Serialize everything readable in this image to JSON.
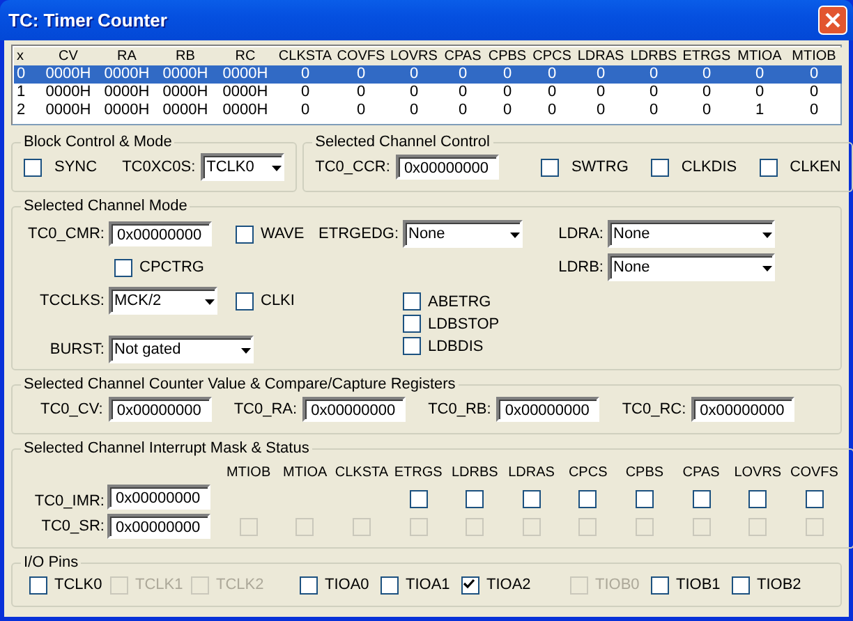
{
  "window": {
    "title": "TC: Timer Counter"
  },
  "table": {
    "columns": [
      "x",
      "CV",
      "RA",
      "RB",
      "RC",
      "CLKSTA",
      "COVFS",
      "LOVRS",
      "CPAS",
      "CPBS",
      "CPCS",
      "LDRAS",
      "LDRBS",
      "ETRGS",
      "MTIOA",
      "MTIOB"
    ],
    "rows": [
      {
        "selected": true,
        "cells": [
          "0",
          "0000H",
          "0000H",
          "0000H",
          "0000H",
          "0",
          "0",
          "0",
          "0",
          "0",
          "0",
          "0",
          "0",
          "0",
          "0",
          "0"
        ]
      },
      {
        "selected": false,
        "cells": [
          "1",
          "0000H",
          "0000H",
          "0000H",
          "0000H",
          "0",
          "0",
          "0",
          "0",
          "0",
          "0",
          "0",
          "0",
          "0",
          "0",
          "0"
        ]
      },
      {
        "selected": false,
        "cells": [
          "2",
          "0000H",
          "0000H",
          "0000H",
          "0000H",
          "0",
          "0",
          "0",
          "0",
          "0",
          "0",
          "0",
          "0",
          "0",
          "1",
          "0"
        ]
      }
    ]
  },
  "block_control": {
    "title": "Block Control & Mode",
    "sync": {
      "label": "SYNC",
      "checked": false
    },
    "xc0s": {
      "label": "TC0XC0S:",
      "value": "TCLK0"
    }
  },
  "channel_control": {
    "title": "Selected Channel Control",
    "ccr": {
      "label": "TC0_CCR:",
      "value": "0x00000000"
    },
    "toggles": [
      {
        "label": "SWTRG",
        "checked": false
      },
      {
        "label": "CLKDIS",
        "checked": false
      },
      {
        "label": "CLKEN",
        "checked": false
      }
    ]
  },
  "channel_mode": {
    "title": "Selected Channel Mode",
    "cmr": {
      "label": "TC0_CMR:",
      "value": "0x00000000"
    },
    "wave": {
      "label": "WAVE",
      "checked": false
    },
    "etrgedg": {
      "label": "ETRGEDG:",
      "value": "None"
    },
    "ldra": {
      "label": "LDRA:",
      "value": "None"
    },
    "cpctrg": {
      "label": "CPCTRG",
      "checked": false
    },
    "ldrb": {
      "label": "LDRB:",
      "value": "None"
    },
    "tcclks": {
      "label": "TCCLKS:",
      "value": "MCK/2"
    },
    "clki": {
      "label": "CLKI",
      "checked": false
    },
    "abetrg": {
      "label": "ABETRG",
      "checked": false
    },
    "ldbstop": {
      "label": "LDBSTOP",
      "checked": false
    },
    "burst": {
      "label": "BURST:",
      "value": "Not gated"
    },
    "ldbdis": {
      "label": "LDBDIS",
      "checked": false
    }
  },
  "registers": {
    "title": "Selected Channel Counter Value & Compare/Capture Registers",
    "fields": [
      {
        "label": "TC0_CV:",
        "value": "0x00000000"
      },
      {
        "label": "TC0_RA:",
        "value": "0x00000000"
      },
      {
        "label": "TC0_RB:",
        "value": "0x00000000"
      },
      {
        "label": "TC0_RC:",
        "value": "0x00000000"
      }
    ]
  },
  "interrupts": {
    "title": "Selected Channel Interrupt Mask & Status",
    "imr": {
      "label": "TC0_IMR:",
      "value": "0x00000000"
    },
    "sr": {
      "label": "TC0_SR:",
      "value": "0x00000000"
    },
    "bits": [
      {
        "label": "MTIOB",
        "status": {
          "checked": false,
          "disabled": true
        }
      },
      {
        "label": "MTIOA",
        "status": {
          "checked": false,
          "disabled": true
        }
      },
      {
        "label": "CLKSTA",
        "status": {
          "checked": false,
          "disabled": true
        }
      },
      {
        "label": "ETRGS",
        "mask": {
          "checked": false
        },
        "status": {
          "checked": false,
          "disabled": true
        }
      },
      {
        "label": "LDRBS",
        "mask": {
          "checked": false
        },
        "status": {
          "checked": false,
          "disabled": true
        }
      },
      {
        "label": "LDRAS",
        "mask": {
          "checked": false
        },
        "status": {
          "checked": false,
          "disabled": true
        }
      },
      {
        "label": "CPCS",
        "mask": {
          "checked": false
        },
        "status": {
          "checked": false,
          "disabled": true
        }
      },
      {
        "label": "CPBS",
        "mask": {
          "checked": false
        },
        "status": {
          "checked": false,
          "disabled": true
        }
      },
      {
        "label": "CPAS",
        "mask": {
          "checked": false
        },
        "status": {
          "checked": false,
          "disabled": true
        }
      },
      {
        "label": "LOVRS",
        "mask": {
          "checked": false
        },
        "status": {
          "checked": false,
          "disabled": true
        }
      },
      {
        "label": "COVFS",
        "mask": {
          "checked": false
        },
        "status": {
          "checked": false,
          "disabled": true
        }
      }
    ]
  },
  "io_pins": {
    "title": "I/O Pins",
    "pins": [
      {
        "label": "TCLK0",
        "checked": false,
        "disabled": false
      },
      {
        "label": "TCLK1",
        "checked": false,
        "disabled": true
      },
      {
        "label": "TCLK2",
        "checked": false,
        "disabled": true
      },
      {
        "label": "TIOA0",
        "checked": false,
        "disabled": false
      },
      {
        "label": "TIOA1",
        "checked": false,
        "disabled": false
      },
      {
        "label": "TIOA2",
        "checked": true,
        "disabled": false
      },
      {
        "label": "TIOB0",
        "checked": false,
        "disabled": true
      },
      {
        "label": "TIOB1",
        "checked": false,
        "disabled": false
      },
      {
        "label": "TIOB2",
        "checked": false,
        "disabled": false
      }
    ]
  }
}
